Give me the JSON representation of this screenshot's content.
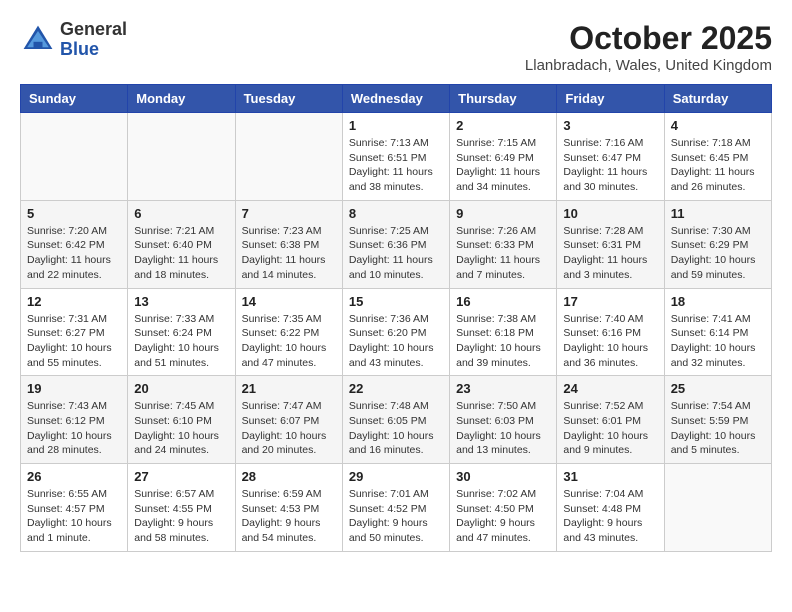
{
  "header": {
    "logo_general": "General",
    "logo_blue": "Blue",
    "month_title": "October 2025",
    "location": "Llanbradach, Wales, United Kingdom"
  },
  "weekdays": [
    "Sunday",
    "Monday",
    "Tuesday",
    "Wednesday",
    "Thursday",
    "Friday",
    "Saturday"
  ],
  "weeks": [
    [
      {
        "day": "",
        "text": ""
      },
      {
        "day": "",
        "text": ""
      },
      {
        "day": "",
        "text": ""
      },
      {
        "day": "1",
        "text": "Sunrise: 7:13 AM\nSunset: 6:51 PM\nDaylight: 11 hours\nand 38 minutes."
      },
      {
        "day": "2",
        "text": "Sunrise: 7:15 AM\nSunset: 6:49 PM\nDaylight: 11 hours\nand 34 minutes."
      },
      {
        "day": "3",
        "text": "Sunrise: 7:16 AM\nSunset: 6:47 PM\nDaylight: 11 hours\nand 30 minutes."
      },
      {
        "day": "4",
        "text": "Sunrise: 7:18 AM\nSunset: 6:45 PM\nDaylight: 11 hours\nand 26 minutes."
      }
    ],
    [
      {
        "day": "5",
        "text": "Sunrise: 7:20 AM\nSunset: 6:42 PM\nDaylight: 11 hours\nand 22 minutes."
      },
      {
        "day": "6",
        "text": "Sunrise: 7:21 AM\nSunset: 6:40 PM\nDaylight: 11 hours\nand 18 minutes."
      },
      {
        "day": "7",
        "text": "Sunrise: 7:23 AM\nSunset: 6:38 PM\nDaylight: 11 hours\nand 14 minutes."
      },
      {
        "day": "8",
        "text": "Sunrise: 7:25 AM\nSunset: 6:36 PM\nDaylight: 11 hours\nand 10 minutes."
      },
      {
        "day": "9",
        "text": "Sunrise: 7:26 AM\nSunset: 6:33 PM\nDaylight: 11 hours\nand 7 minutes."
      },
      {
        "day": "10",
        "text": "Sunrise: 7:28 AM\nSunset: 6:31 PM\nDaylight: 11 hours\nand 3 minutes."
      },
      {
        "day": "11",
        "text": "Sunrise: 7:30 AM\nSunset: 6:29 PM\nDaylight: 10 hours\nand 59 minutes."
      }
    ],
    [
      {
        "day": "12",
        "text": "Sunrise: 7:31 AM\nSunset: 6:27 PM\nDaylight: 10 hours\nand 55 minutes."
      },
      {
        "day": "13",
        "text": "Sunrise: 7:33 AM\nSunset: 6:24 PM\nDaylight: 10 hours\nand 51 minutes."
      },
      {
        "day": "14",
        "text": "Sunrise: 7:35 AM\nSunset: 6:22 PM\nDaylight: 10 hours\nand 47 minutes."
      },
      {
        "day": "15",
        "text": "Sunrise: 7:36 AM\nSunset: 6:20 PM\nDaylight: 10 hours\nand 43 minutes."
      },
      {
        "day": "16",
        "text": "Sunrise: 7:38 AM\nSunset: 6:18 PM\nDaylight: 10 hours\nand 39 minutes."
      },
      {
        "day": "17",
        "text": "Sunrise: 7:40 AM\nSunset: 6:16 PM\nDaylight: 10 hours\nand 36 minutes."
      },
      {
        "day": "18",
        "text": "Sunrise: 7:41 AM\nSunset: 6:14 PM\nDaylight: 10 hours\nand 32 minutes."
      }
    ],
    [
      {
        "day": "19",
        "text": "Sunrise: 7:43 AM\nSunset: 6:12 PM\nDaylight: 10 hours\nand 28 minutes."
      },
      {
        "day": "20",
        "text": "Sunrise: 7:45 AM\nSunset: 6:10 PM\nDaylight: 10 hours\nand 24 minutes."
      },
      {
        "day": "21",
        "text": "Sunrise: 7:47 AM\nSunset: 6:07 PM\nDaylight: 10 hours\nand 20 minutes."
      },
      {
        "day": "22",
        "text": "Sunrise: 7:48 AM\nSunset: 6:05 PM\nDaylight: 10 hours\nand 16 minutes."
      },
      {
        "day": "23",
        "text": "Sunrise: 7:50 AM\nSunset: 6:03 PM\nDaylight: 10 hours\nand 13 minutes."
      },
      {
        "day": "24",
        "text": "Sunrise: 7:52 AM\nSunset: 6:01 PM\nDaylight: 10 hours\nand 9 minutes."
      },
      {
        "day": "25",
        "text": "Sunrise: 7:54 AM\nSunset: 5:59 PM\nDaylight: 10 hours\nand 5 minutes."
      }
    ],
    [
      {
        "day": "26",
        "text": "Sunrise: 6:55 AM\nSunset: 4:57 PM\nDaylight: 10 hours\nand 1 minute."
      },
      {
        "day": "27",
        "text": "Sunrise: 6:57 AM\nSunset: 4:55 PM\nDaylight: 9 hours\nand 58 minutes."
      },
      {
        "day": "28",
        "text": "Sunrise: 6:59 AM\nSunset: 4:53 PM\nDaylight: 9 hours\nand 54 minutes."
      },
      {
        "day": "29",
        "text": "Sunrise: 7:01 AM\nSunset: 4:52 PM\nDaylight: 9 hours\nand 50 minutes."
      },
      {
        "day": "30",
        "text": "Sunrise: 7:02 AM\nSunset: 4:50 PM\nDaylight: 9 hours\nand 47 minutes."
      },
      {
        "day": "31",
        "text": "Sunrise: 7:04 AM\nSunset: 4:48 PM\nDaylight: 9 hours\nand 43 minutes."
      },
      {
        "day": "",
        "text": ""
      }
    ]
  ]
}
